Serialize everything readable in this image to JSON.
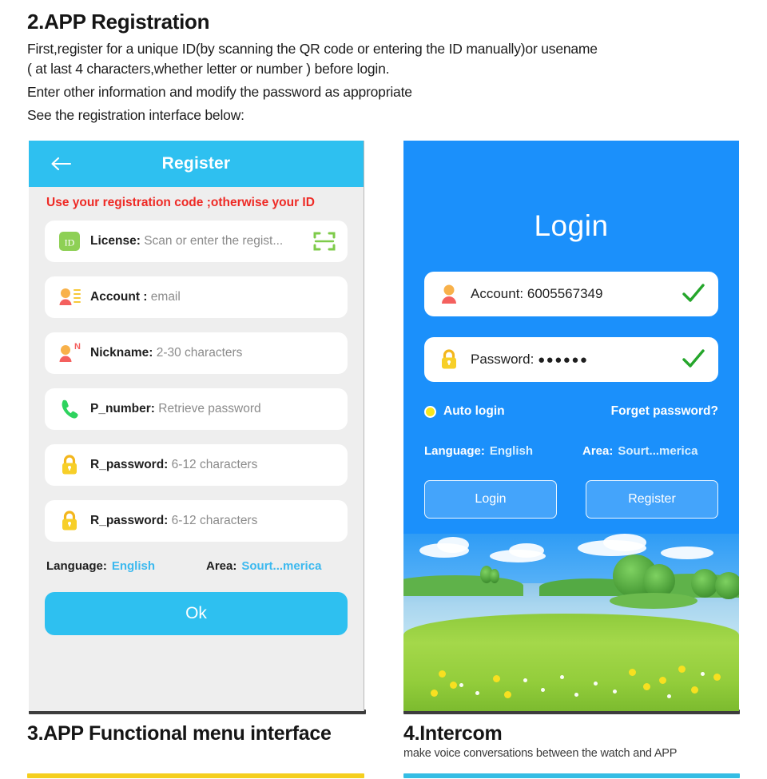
{
  "document": {
    "section_title": "2.APP Registration",
    "paragraphs": [
      "First,register for a unique ID(by scanning the QR code or entering the ID manually)or usename",
      "( at last 4 characters,whether letter or number ) before login.",
      "Enter other information and modify the password as appropriate",
      "See the registration interface below:"
    ]
  },
  "register_screen": {
    "back_icon": "back-arrow-icon",
    "title": "Register",
    "warning": "Use your registration code ;otherwise your ID",
    "fields": [
      {
        "icon": "id-badge-icon",
        "icon_text": "ID",
        "label": "License:",
        "placeholder": "Scan or enter the regist...",
        "trailing_icon": "qr-scan-icon"
      },
      {
        "icon": "contact-card-icon",
        "icon_text": "",
        "label": "Account :",
        "placeholder": "email",
        "trailing_icon": ""
      },
      {
        "icon": "nickname-user-icon",
        "icon_text": "N",
        "label": "Nickname:",
        "placeholder": "2-30 characters",
        "trailing_icon": ""
      },
      {
        "icon": "phone-icon",
        "icon_text": "",
        "label": "P_number:",
        "placeholder": "Retrieve password",
        "trailing_icon": ""
      },
      {
        "icon": "lock-icon",
        "icon_text": "",
        "label": "R_password:",
        "placeholder": "6-12 characters",
        "trailing_icon": ""
      },
      {
        "icon": "lock-icon",
        "icon_text": "",
        "label": "R_password:",
        "placeholder": "6-12 characters",
        "trailing_icon": ""
      }
    ],
    "language_label": "Language:",
    "language_value": "English",
    "area_label": "Area:",
    "area_value": "Sourt...merica",
    "ok_button": "Ok"
  },
  "login_screen": {
    "title": "Login",
    "account_label": "Account:",
    "account_value": "6005567349",
    "account_icon": "user-avatar-icon",
    "account_valid_icon": "green-check-icon",
    "password_label": "Password:",
    "password_value": "●●●●●●",
    "password_icon": "lock-icon",
    "password_valid_icon": "green-check-icon",
    "auto_login_label": "Auto login",
    "auto_login_checked": true,
    "forget_password_label": "Forget password?",
    "language_label": "Language:",
    "language_value": "English",
    "area_label": "Area:",
    "area_value": "Sourt...merica",
    "login_button": "Login",
    "register_button": "Register"
  },
  "footer": {
    "left_title": "3.APP Functional menu interface",
    "right_title": "4.Intercom",
    "right_subtitle": "make voice conversations between the watch and APP"
  },
  "colors": {
    "register_header": "#2ec0f0",
    "register_body": "#eeeeee",
    "login_background": "#1b90fb",
    "warning_red": "#ee2a25",
    "link_blue": "#3cb9ef",
    "accent_yellow": "#f5cf1e",
    "accent_cyan": "#35bde4",
    "id_badge_green": "#8ed055"
  }
}
